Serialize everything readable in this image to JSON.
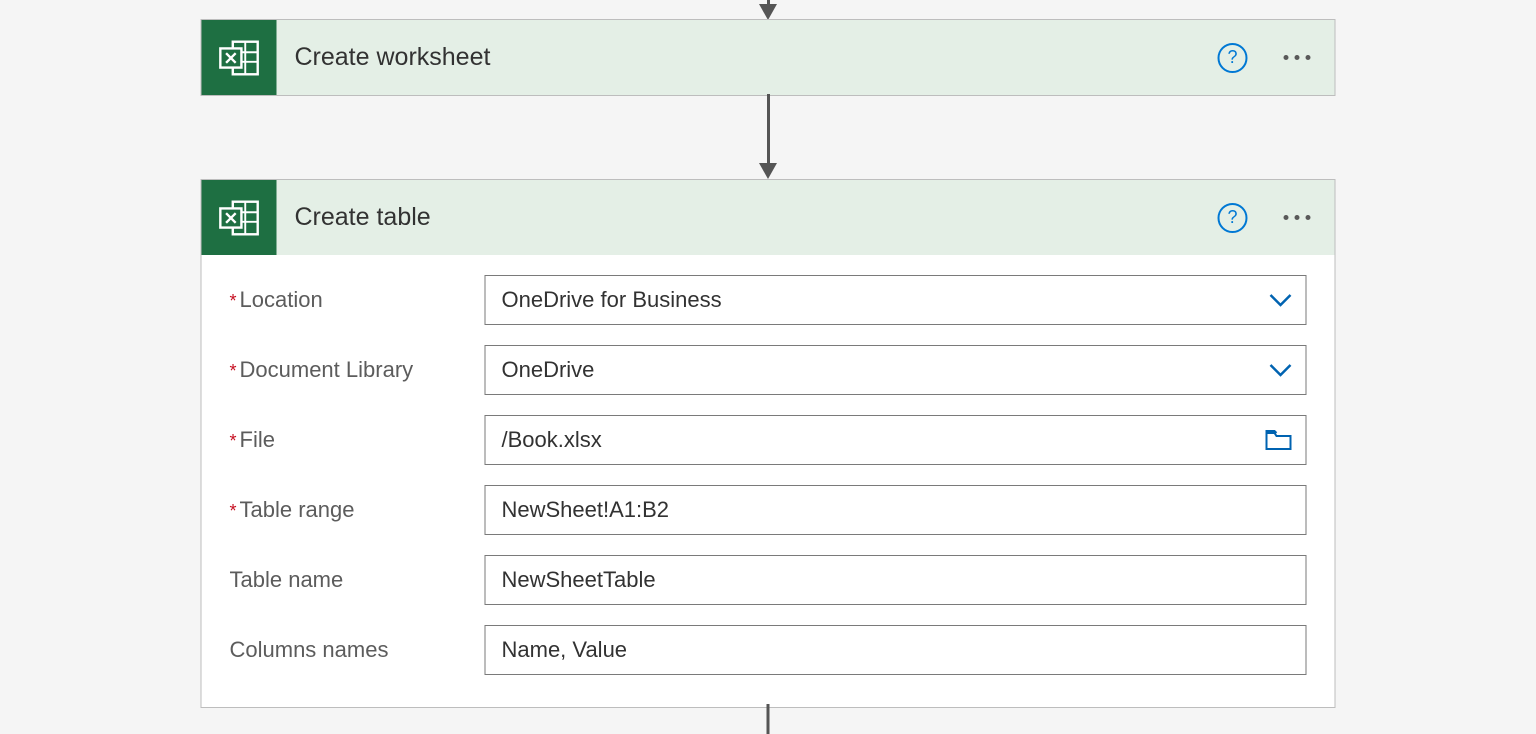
{
  "actions": {
    "create_worksheet": {
      "title": "Create worksheet"
    },
    "create_table": {
      "title": "Create table",
      "fields": [
        {
          "label": "Location",
          "required": true,
          "value": "OneDrive for Business",
          "adornment": "chevron"
        },
        {
          "label": "Document Library",
          "required": true,
          "value": "OneDrive",
          "adornment": "chevron"
        },
        {
          "label": "File",
          "required": true,
          "value": "/Book.xlsx",
          "adornment": "folder"
        },
        {
          "label": "Table range",
          "required": true,
          "value": "NewSheet!A1:B2",
          "adornment": "none"
        },
        {
          "label": "Table name",
          "required": false,
          "value": "NewSheetTable",
          "adornment": "none"
        },
        {
          "label": "Columns names",
          "required": false,
          "value": "Name, Value",
          "adornment": "none"
        }
      ]
    }
  }
}
